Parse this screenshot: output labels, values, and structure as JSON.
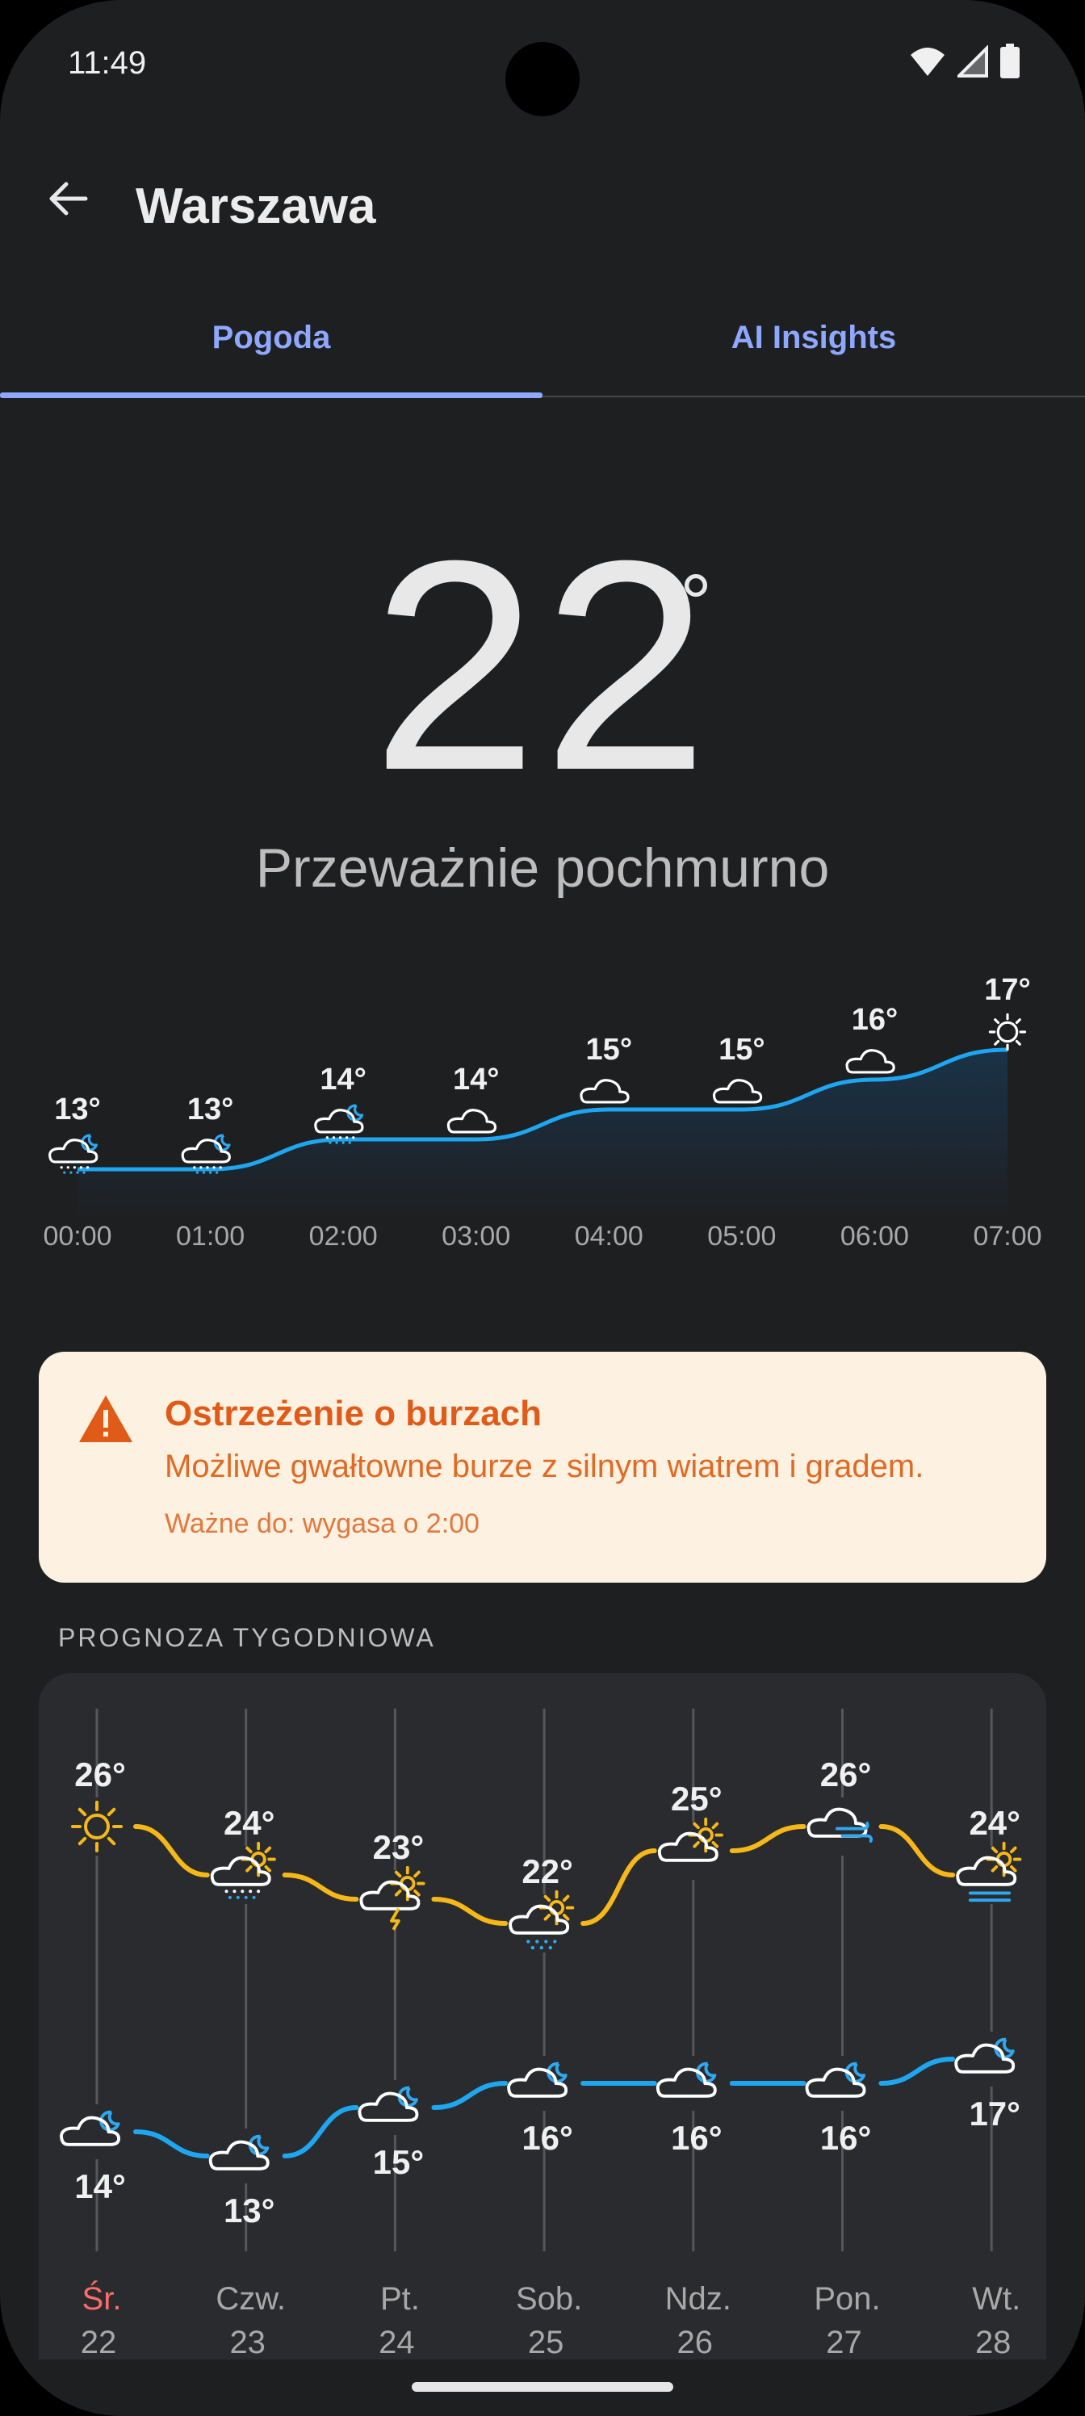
{
  "status_bar": {
    "time": "11:49"
  },
  "app_bar": {
    "title": "Warszawa"
  },
  "tabs": [
    {
      "label": "Pogoda",
      "selected": true
    },
    {
      "label": "AI Insights",
      "selected": false
    }
  ],
  "current": {
    "temperature": "22",
    "degree": "°",
    "condition": "Przeważnie pochmurno"
  },
  "hourly": [
    {
      "time": "00:00",
      "temp": 13,
      "label": "13°",
      "icon": "night-cloud-drizzle-icon"
    },
    {
      "time": "01:00",
      "temp": 13,
      "label": "13°",
      "icon": "night-cloud-drizzle-icon"
    },
    {
      "time": "02:00",
      "temp": 14,
      "label": "14°",
      "icon": "night-cloud-drizzle-icon"
    },
    {
      "time": "03:00",
      "temp": 14,
      "label": "14°",
      "icon": "cloud-icon"
    },
    {
      "time": "04:00",
      "temp": 15,
      "label": "15°",
      "icon": "cloud-icon"
    },
    {
      "time": "05:00",
      "temp": 15,
      "label": "15°",
      "icon": "cloud-icon"
    },
    {
      "time": "06:00",
      "temp": 16,
      "label": "16°",
      "icon": "cloud-icon"
    },
    {
      "time": "07:00",
      "temp": 17,
      "label": "17°",
      "icon": "sun-icon"
    }
  ],
  "alert": {
    "title": "Ostrzeżenie o burzach",
    "text": "Możliwe gwałtowne burze z silnym wiatrem i gradem.",
    "valid": "Ważne do: wygasa o 2:00"
  },
  "weekly": {
    "section_label": "PROGNOZA TYGODNIOWA",
    "days": [
      {
        "day": "Śr.",
        "date": "22",
        "high": 26,
        "high_label": "26°",
        "low": 14,
        "low_label": "14°",
        "day_icon": "sun-icon",
        "night_icon": "night-cloud-icon",
        "today": true
      },
      {
        "day": "Czw.",
        "date": "23",
        "high": 24,
        "high_label": "24°",
        "low": 13,
        "low_label": "13°",
        "day_icon": "sun-cloud-drizzle-icon",
        "night_icon": "night-cloud-icon",
        "today": false
      },
      {
        "day": "Pt.",
        "date": "24",
        "high": 23,
        "high_label": "23°",
        "low": 15,
        "low_label": "15°",
        "day_icon": "sun-cloud-storm-icon",
        "night_icon": "night-cloud-icon",
        "today": false
      },
      {
        "day": "Sob.",
        "date": "25",
        "high": 22,
        "high_label": "22°",
        "low": 16,
        "low_label": "16°",
        "day_icon": "sun-cloud-snow-icon",
        "night_icon": "night-cloud-icon",
        "today": false
      },
      {
        "day": "Ndz.",
        "date": "26",
        "high": 25,
        "high_label": "25°",
        "low": 16,
        "low_label": "16°",
        "day_icon": "sun-cloud-icon",
        "night_icon": "night-cloud-icon",
        "today": false
      },
      {
        "day": "Pon.",
        "date": "27",
        "high": 26,
        "high_label": "26°",
        "low": 16,
        "low_label": "16°",
        "day_icon": "cloud-wind-icon",
        "night_icon": "night-cloud-icon",
        "today": false
      },
      {
        "day": "Wt.",
        "date": "28",
        "high": 24,
        "high_label": "24°",
        "low": 17,
        "low_label": "17°",
        "day_icon": "sun-cloud-fog-icon",
        "night_icon": "night-cloud-icon",
        "today": false
      }
    ]
  },
  "colors": {
    "accent": "#8fa8ff",
    "hourly_line": "#1ea7f0",
    "high_line": "#f5b818",
    "low_line": "#1ea7f0",
    "alert_text": "#e05b18",
    "today": "#ff6b6b"
  }
}
